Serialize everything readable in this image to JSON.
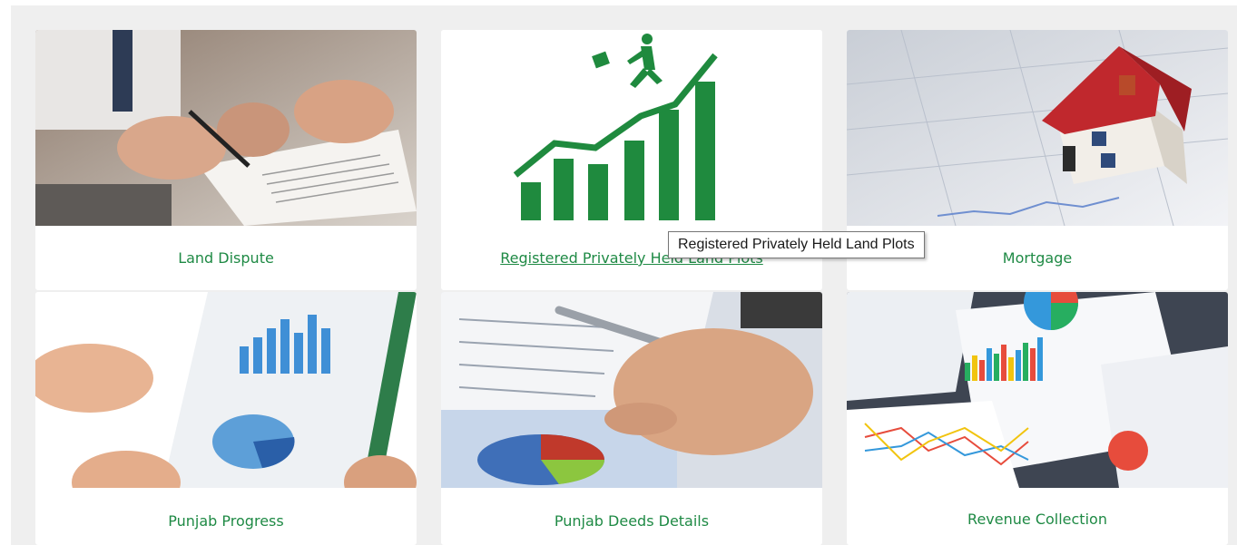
{
  "cards": [
    {
      "label": "Land Dispute",
      "image": "handshake-contract-signing"
    },
    {
      "label": "Registered Privately Held Land Plots",
      "image": "growth-chart-runner-icon"
    },
    {
      "label": "Mortgage",
      "image": "house-on-financial-chart"
    },
    {
      "label": "Punjab Progress",
      "image": "bar-chart-tablet"
    },
    {
      "label": "Punjab Deeds Details",
      "image": "pen-on-report"
    },
    {
      "label": "Revenue Collection",
      "image": "colorful-charts-papers"
    }
  ],
  "tooltip": {
    "text": "Registered Privately Held Land Plots"
  },
  "colors": {
    "accent": "#1f8a45",
    "panel_bg": "#efefef"
  }
}
